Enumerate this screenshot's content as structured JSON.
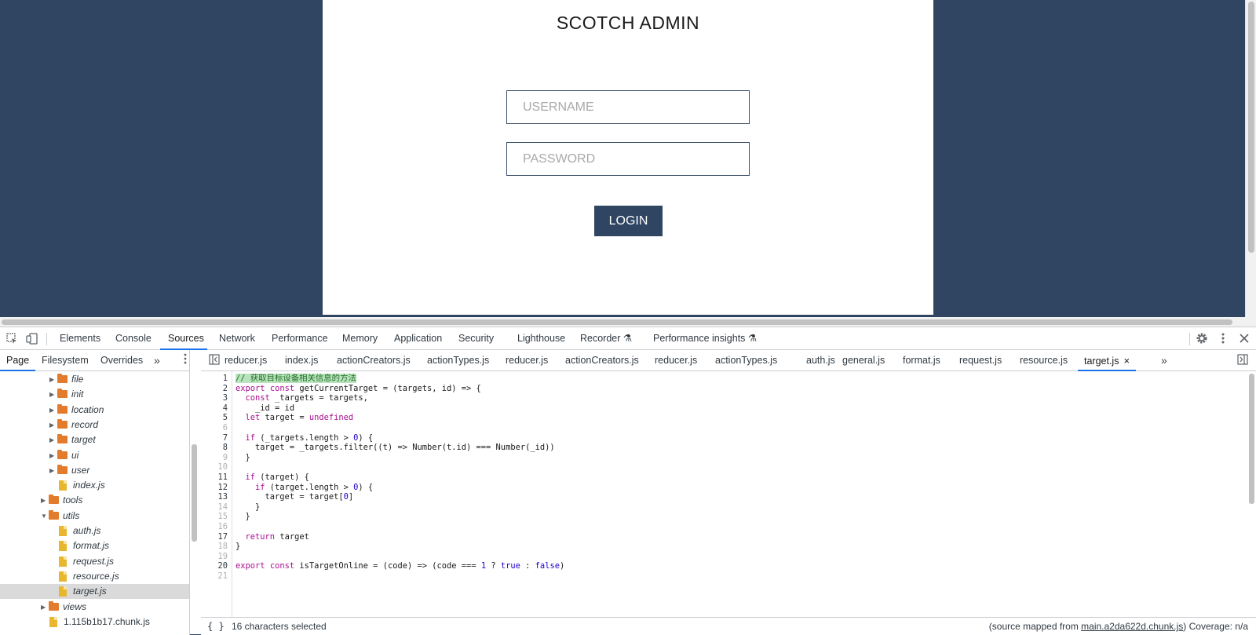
{
  "page": {
    "title": "SCOTCH ADMIN",
    "username_placeholder": "USERNAME",
    "password_placeholder": "PASSWORD",
    "login_label": "LOGIN"
  },
  "devtools": {
    "panel_tabs": [
      "Elements",
      "Console",
      "Sources",
      "Network",
      "Performance",
      "Memory",
      "Application",
      "Security",
      "Lighthouse",
      "Recorder ⚗",
      "Performance insights ⚗"
    ],
    "active_panel": "Sources",
    "nav_tabs": [
      "Page",
      "Filesystem",
      "Overrides"
    ],
    "more_tabs": "»",
    "tree": [
      {
        "label": "file",
        "type": "folder",
        "depth": 2,
        "expanded": false
      },
      {
        "label": "init",
        "type": "folder",
        "depth": 2,
        "expanded": false
      },
      {
        "label": "location",
        "type": "folder",
        "depth": 2,
        "expanded": false
      },
      {
        "label": "record",
        "type": "folder",
        "depth": 2,
        "expanded": false
      },
      {
        "label": "target",
        "type": "folder",
        "depth": 2,
        "expanded": false
      },
      {
        "label": "ui",
        "type": "folder",
        "depth": 2,
        "expanded": false
      },
      {
        "label": "user",
        "type": "folder",
        "depth": 2,
        "expanded": false
      },
      {
        "label": "index.js",
        "type": "file",
        "depth": 2
      },
      {
        "label": "tools",
        "type": "folder",
        "depth": 1,
        "expanded": false
      },
      {
        "label": "utils",
        "type": "folder",
        "depth": 1,
        "expanded": true
      },
      {
        "label": "auth.js",
        "type": "file",
        "depth": 2
      },
      {
        "label": "format.js",
        "type": "file",
        "depth": 2
      },
      {
        "label": "request.js",
        "type": "file",
        "depth": 2
      },
      {
        "label": "resource.js",
        "type": "file",
        "depth": 2
      },
      {
        "label": "target.js",
        "type": "file",
        "depth": 2,
        "selected": true
      },
      {
        "label": "views",
        "type": "folder",
        "depth": 1,
        "expanded": false
      },
      {
        "label": "1.115b1b17.chunk.js",
        "type": "file",
        "depth": 1,
        "plain": true
      }
    ],
    "file_tabs": [
      "reducer.js",
      "index.js",
      "actionCreators.js",
      "actionTypes.js",
      "reducer.js",
      "actionCreators.js",
      "reducer.js",
      "actionTypes.js",
      "auth.js",
      "general.js",
      "format.js",
      "request.js",
      "resource.js",
      "target.js"
    ],
    "active_file": "target.js",
    "close_glyph": "×",
    "status": {
      "format_label": "{ }",
      "selection": "16 characters selected",
      "source_map_prefix": "(source mapped from ",
      "source_map_file": "main.a2da622d.chunk.js",
      "source_map_suffix": ")",
      "coverage": "Coverage: n/a"
    }
  },
  "code_lines": [
    "// 获取目标设备相关信息的方法",
    "export const getCurrentTarget = (targets, id) => {",
    "  const _targets = targets,",
    "    _id = id",
    "  let target = undefined",
    "",
    "  if (_targets.length > 0) {",
    "    target = _targets.filter((t) => Number(t.id) === Number(_id))",
    "  }",
    "",
    "  if (target) {",
    "    if (target.length > 0) {",
    "      target = target[0]",
    "    }",
    "  }",
    "",
    "  return target",
    "}",
    "",
    "export const isTargetOnline = (code) => (code === 1 ? true : false)",
    ""
  ],
  "dim_lines": [
    6,
    9,
    10,
    14,
    15,
    16,
    18,
    19,
    21
  ],
  "colors": {
    "page_background": "#2f4562",
    "login_button": "#2f4562",
    "folder_icon": "#e37b2c",
    "file_icon": "#e8b72e",
    "active_tab_underline": "#1a73e8"
  }
}
